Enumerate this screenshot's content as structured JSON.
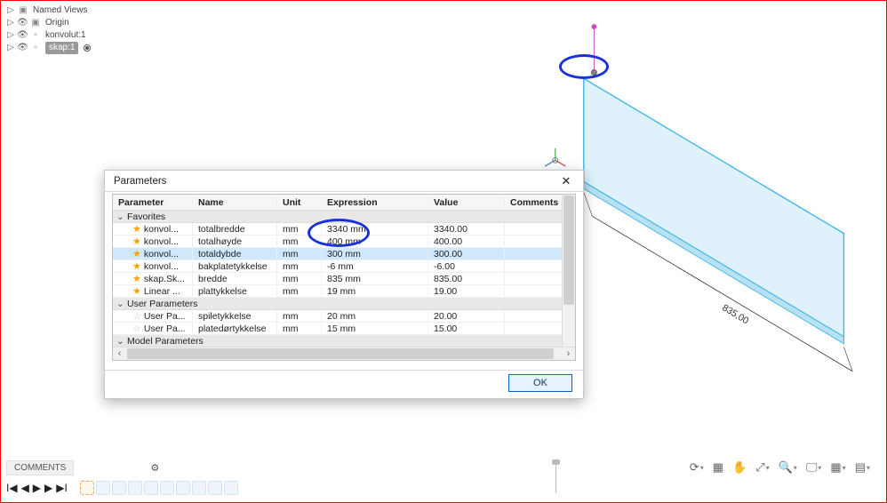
{
  "browser": {
    "items": [
      {
        "label": "Named Views",
        "icon": "📁",
        "eye": false
      },
      {
        "label": "Origin",
        "icon": "📁",
        "eye": true
      },
      {
        "label": "konvolut:1",
        "icon": "▫",
        "eye": true
      },
      {
        "label": "skap:1",
        "icon": "▫",
        "eye": true,
        "selected": true,
        "radio": true
      }
    ]
  },
  "dialog": {
    "title": "Parameters",
    "headers": {
      "parameter": "Parameter",
      "name": "Name",
      "unit": "Unit",
      "expression": "Expression",
      "value": "Value",
      "comments": "Comments"
    },
    "groups": {
      "favorites": "Favorites",
      "user": "User Parameters",
      "model": "Model Parameters"
    },
    "rows": [
      {
        "group": "favorites",
        "fav": true,
        "parameter": "konvol...",
        "name": "totalbredde",
        "unit": "mm",
        "expression": "3340 mm",
        "value": "3340.00"
      },
      {
        "group": "favorites",
        "fav": true,
        "parameter": "konvol...",
        "name": "totalhøyde",
        "unit": "mm",
        "expression": "400 mm",
        "value": "400.00"
      },
      {
        "group": "favorites",
        "fav": true,
        "parameter": "konvol...",
        "name": "totaldybde",
        "unit": "mm",
        "expression": "300 mm",
        "value": "300.00",
        "selected": true
      },
      {
        "group": "favorites",
        "fav": true,
        "parameter": "konvol...",
        "name": "bakplatetykkelse",
        "unit": "mm",
        "expression": "-6 mm",
        "value": "-6.00"
      },
      {
        "group": "favorites",
        "fav": true,
        "parameter": "skap.Sk...",
        "name": "bredde",
        "unit": "mm",
        "expression": "835 mm",
        "value": "835.00"
      },
      {
        "group": "favorites",
        "fav": true,
        "parameter": "Linear ...",
        "name": "plattykkelse",
        "unit": "mm",
        "expression": "19 mm",
        "value": "19.00"
      },
      {
        "group": "user",
        "fav": false,
        "parameter": "User Pa...",
        "name": "spiletykkelse",
        "unit": "mm",
        "expression": "20 mm",
        "value": "20.00"
      },
      {
        "group": "user",
        "fav": false,
        "parameter": "User Pa...",
        "name": "platedørtykkelse",
        "unit": "mm",
        "expression": "15 mm",
        "value": "15.00"
      }
    ],
    "ok": "OK"
  },
  "viewport": {
    "dim_label": "835,00"
  },
  "bottom": {
    "comments": "COMMENTS"
  },
  "chart_data": {
    "type": "table",
    "title": "Parameters",
    "columns": [
      "Parameter",
      "Name",
      "Unit",
      "Expression",
      "Value",
      "Comments"
    ],
    "rows": [
      [
        "konvol...",
        "totalbredde",
        "mm",
        "3340 mm",
        3340.0,
        ""
      ],
      [
        "konvol...",
        "totalhøyde",
        "mm",
        "400 mm",
        400.0,
        ""
      ],
      [
        "konvol...",
        "totaldybde",
        "mm",
        "300 mm",
        300.0,
        ""
      ],
      [
        "konvol...",
        "bakplatetykkelse",
        "mm",
        "-6 mm",
        -6.0,
        ""
      ],
      [
        "skap.Sk...",
        "bredde",
        "mm",
        "835 mm",
        835.0,
        ""
      ],
      [
        "Linear ...",
        "plattykkelse",
        "mm",
        "19 mm",
        19.0,
        ""
      ],
      [
        "User Pa...",
        "spiletykkelse",
        "mm",
        "20 mm",
        20.0,
        ""
      ],
      [
        "User Pa...",
        "platedørtykkelse",
        "mm",
        "15 mm",
        15.0,
        ""
      ]
    ]
  }
}
